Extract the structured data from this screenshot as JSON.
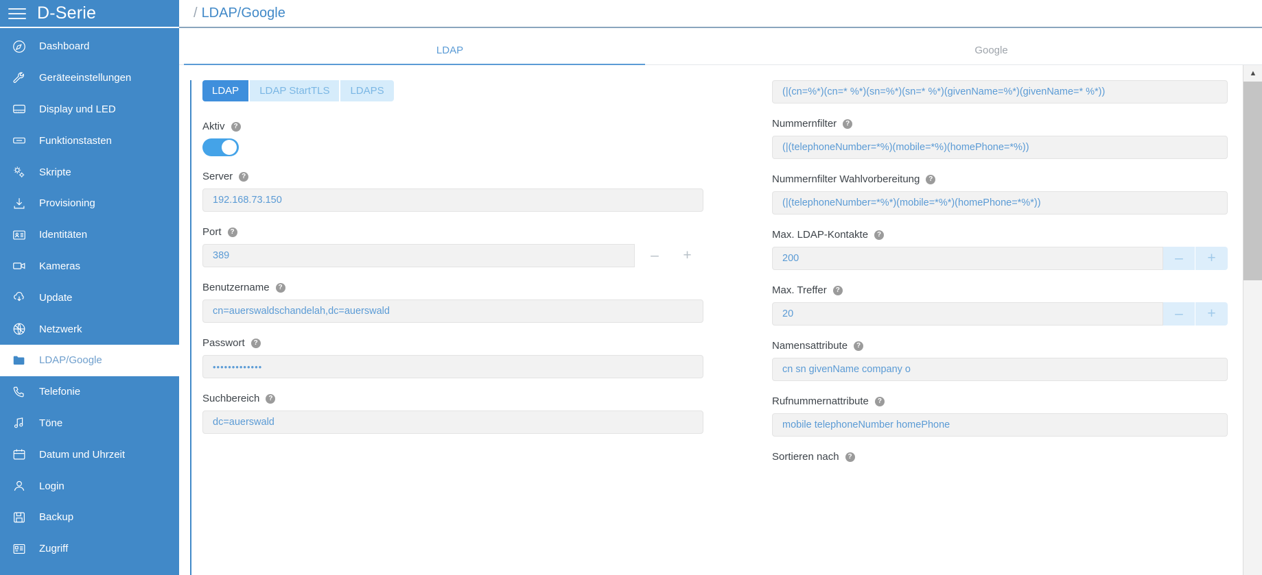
{
  "sidebar": {
    "brand": "D-Serie",
    "menu_icon": "hamburger-icon",
    "items": [
      {
        "label": "Dashboard",
        "icon": "compass-icon"
      },
      {
        "label": "Geräteeinstellungen",
        "icon": "wrench-icon"
      },
      {
        "label": "Display und LED",
        "icon": "display-icon"
      },
      {
        "label": "Funktionstasten",
        "icon": "key-icon"
      },
      {
        "label": "Skripte",
        "icon": "gears-icon"
      },
      {
        "label": "Provisioning",
        "icon": "download-icon"
      },
      {
        "label": "Identitäten",
        "icon": "id-card-icon"
      },
      {
        "label": "Kameras",
        "icon": "camera-icon"
      },
      {
        "label": "Update",
        "icon": "cloud-download-icon"
      },
      {
        "label": "Netzwerk",
        "icon": "network-icon"
      },
      {
        "label": "LDAP/Google",
        "icon": "folder-icon",
        "active": true
      },
      {
        "label": "Telefonie",
        "icon": "phone-icon"
      },
      {
        "label": "Töne",
        "icon": "music-note-icon"
      },
      {
        "label": "Datum und Uhrzeit",
        "icon": "calendar-icon"
      },
      {
        "label": "Login",
        "icon": "user-icon"
      },
      {
        "label": "Backup",
        "icon": "save-icon"
      },
      {
        "label": "Zugriff",
        "icon": "desk-phone-icon"
      }
    ]
  },
  "breadcrumb": {
    "separator": "/",
    "current": "LDAP/Google"
  },
  "tabs": [
    {
      "label": "LDAP",
      "active": true
    },
    {
      "label": "Google",
      "active": false
    }
  ],
  "protocol_segments": [
    {
      "label": "LDAP",
      "active": true
    },
    {
      "label": "LDAP StartTLS",
      "active": false
    },
    {
      "label": "LDAPS",
      "active": false
    }
  ],
  "help_glyph": "?",
  "left_column": {
    "aktiv": {
      "label": "Aktiv",
      "toggle_on": true
    },
    "server": {
      "label": "Server",
      "value": "192.168.73.150"
    },
    "port": {
      "label": "Port",
      "value": "389",
      "minus": "–",
      "plus": "+"
    },
    "benutzername": {
      "label": "Benutzername",
      "value": "cn=auerswaldschandelah,dc=auerswald"
    },
    "passwort": {
      "label": "Passwort",
      "value": "•••••••••••••"
    },
    "suchbereich": {
      "label": "Suchbereich",
      "value": "dc=auerswald"
    }
  },
  "right_column": {
    "namensfilter": {
      "value": "(|(cn=%*)(cn=* %*)(sn=%*)(sn=* %*)(givenName=%*)(givenName=* %*))"
    },
    "nummernfilter": {
      "label": "Nummernfilter",
      "value": "(|(telephoneNumber=*%)(mobile=*%)(homePhone=*%))"
    },
    "nummernfilter_wahlvorbereitung": {
      "label": "Nummernfilter Wahlvorbereitung",
      "value": "(|(telephoneNumber=*%*)(mobile=*%*)(homePhone=*%*))"
    },
    "max_ldap_kontakte": {
      "label": "Max. LDAP-Kontakte",
      "value": "200",
      "minus": "–",
      "plus": "+"
    },
    "max_treffer": {
      "label": "Max. Treffer",
      "value": "20",
      "minus": "–",
      "plus": "+"
    },
    "namensattribute": {
      "label": "Namensattribute",
      "value": "cn sn givenName company o"
    },
    "rufnummernattribute": {
      "label": "Rufnummernattribute",
      "value": "mobile telephoneNumber homePhone"
    },
    "sortieren_nach": {
      "label": "Sortieren nach"
    }
  },
  "scrollbar": {
    "up_arrow": "▲"
  },
  "colors": {
    "sidebar": "#4189c8",
    "accent": "#5b9bd5",
    "input_text": "#5b9bd5",
    "input_bg": "#f2f2f2",
    "segment_active": "#3f8fdc"
  }
}
